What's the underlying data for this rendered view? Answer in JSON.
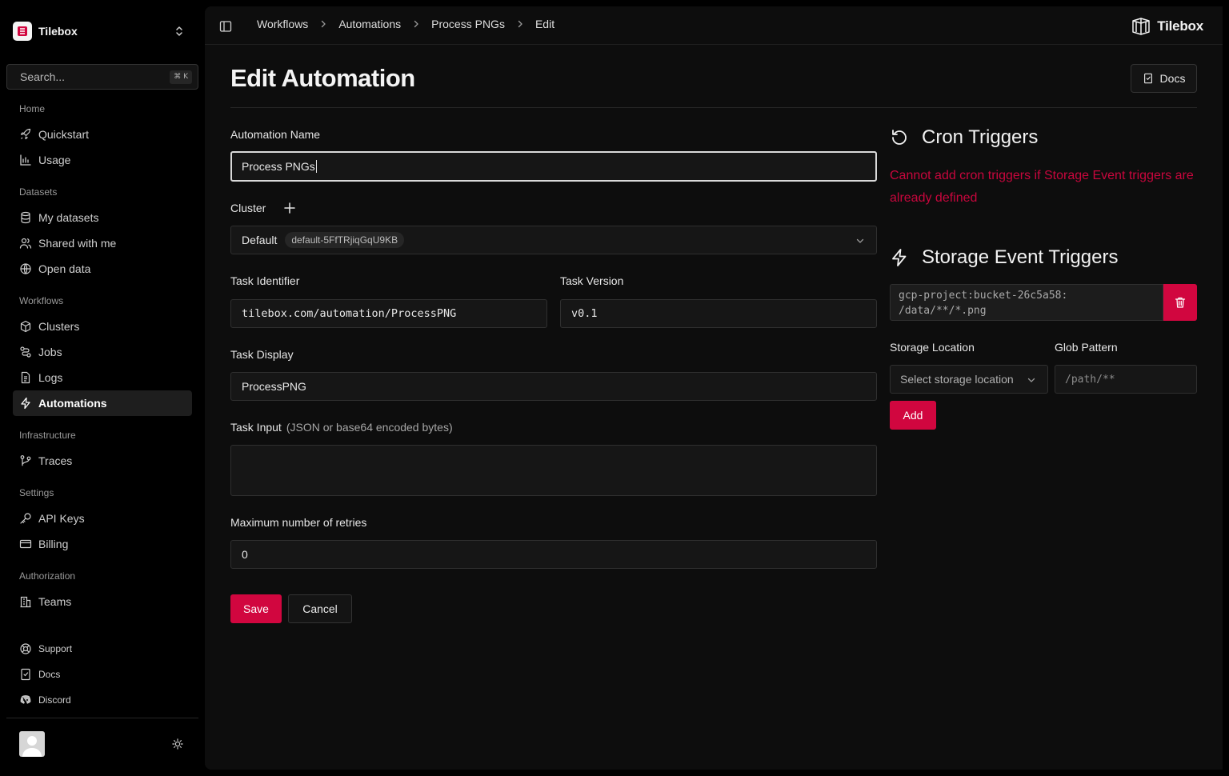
{
  "sidebar": {
    "team_name": "Tilebox",
    "search_placeholder": "Search...",
    "search_shortcut": "⌘ K",
    "sections": {
      "home": "Home",
      "datasets": "Datasets",
      "workflows": "Workflows",
      "infrastructure": "Infrastructure",
      "settings": "Settings",
      "authorization": "Authorization"
    },
    "items": {
      "quickstart": "Quickstart",
      "usage": "Usage",
      "my_datasets": "My datasets",
      "shared_with_me": "Shared with me",
      "open_data": "Open data",
      "clusters": "Clusters",
      "jobs": "Jobs",
      "logs": "Logs",
      "automations": "Automations",
      "traces": "Traces",
      "api_keys": "API Keys",
      "billing": "Billing",
      "teams": "Teams"
    },
    "footer": {
      "support": "Support",
      "docs": "Docs",
      "discord": "Discord"
    }
  },
  "header": {
    "breadcrumb": [
      "Workflows",
      "Automations",
      "Process PNGs",
      "Edit"
    ],
    "brand": "Tilebox"
  },
  "page": {
    "title": "Edit Automation",
    "docs_label": "Docs"
  },
  "form": {
    "automation_name_label": "Automation Name",
    "automation_name_value": "Process PNGs",
    "cluster_label": "Cluster",
    "cluster_value": "Default",
    "cluster_slug": "default-5FfTRjiqGqU9KB",
    "task_identifier_label": "Task Identifier",
    "task_identifier_value": "tilebox.com/automation/ProcessPNG",
    "task_version_label": "Task Version",
    "task_version_value": "v0.1",
    "task_display_label": "Task Display",
    "task_display_value": "ProcessPNG",
    "task_input_label": "Task Input",
    "task_input_hint": "(JSON or base64 encoded bytes)",
    "task_input_value": "",
    "max_retries_label": "Maximum number of retries",
    "max_retries_value": "0",
    "save_label": "Save",
    "cancel_label": "Cancel"
  },
  "triggers": {
    "cron_title": "Cron Triggers",
    "cron_warning": "Cannot add cron triggers if Storage Event triggers are already defined",
    "storage_title": "Storage Event Triggers",
    "storage_trigger_line1": "gcp-project:bucket-26c5a58:",
    "storage_trigger_line2": "/data/**/*.png",
    "storage_location_label": "Storage Location",
    "storage_location_placeholder": "Select storage location",
    "glob_pattern_label": "Glob Pattern",
    "glob_pattern_placeholder": "/path/**",
    "add_label": "Add"
  },
  "colors": {
    "accent": "#d1063f",
    "background": "#0d0d0d",
    "sidebar": "#000000"
  }
}
